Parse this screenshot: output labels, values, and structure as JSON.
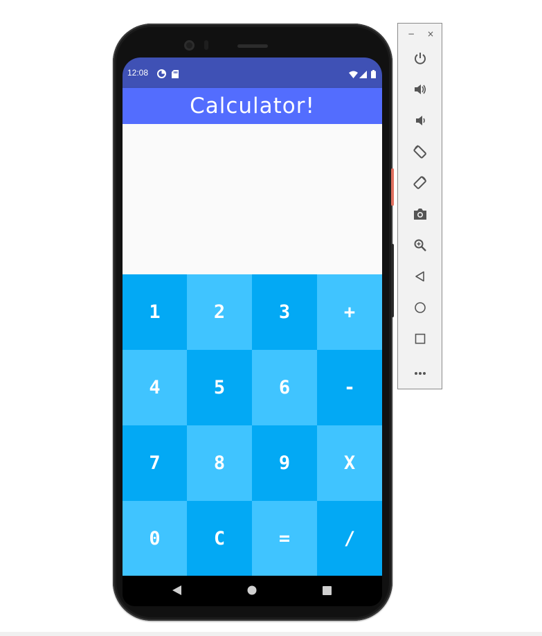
{
  "status_bar": {
    "time": "12:08"
  },
  "app_bar": {
    "title": "Calculator!"
  },
  "display": {
    "value": ""
  },
  "keypad": {
    "keys": [
      "1",
      "2",
      "3",
      "+",
      "4",
      "5",
      "6",
      "-",
      "7",
      "8",
      "9",
      "X",
      "0",
      "C",
      "=",
      "/"
    ]
  },
  "colors": {
    "status_bar": "#3f51b5",
    "app_bar": "#536dfe",
    "key_dark": "#03a9f4",
    "key_light": "#40c4ff"
  },
  "navigation": {
    "icons": [
      "back-icon",
      "home-icon",
      "recents-icon"
    ]
  },
  "emulator_toolbar": {
    "window_controls": [
      "−",
      "×"
    ],
    "icons": [
      "power-icon",
      "volume-up-icon",
      "volume-down-icon",
      "rotate-left-icon",
      "rotate-right-icon",
      "camera-icon",
      "zoom-icon",
      "back-icon",
      "home-icon",
      "overview-icon",
      "more-icon"
    ]
  }
}
